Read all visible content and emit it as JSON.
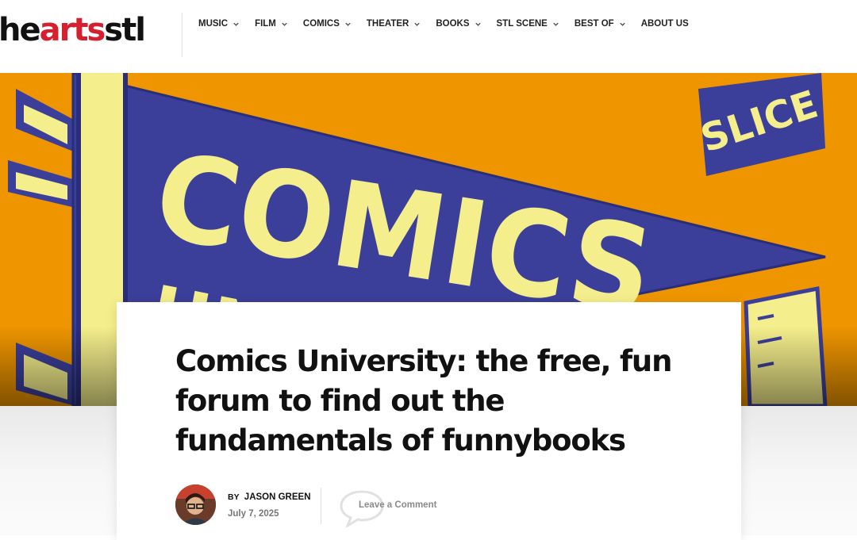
{
  "site": {
    "logo_part1": "he",
    "logo_part2": "arts",
    "logo_part3": "stl",
    "logo_color_dark": "#111111",
    "logo_color_red": "#d6202f"
  },
  "nav": {
    "items": [
      {
        "label": "MUSIC",
        "has_dropdown": true
      },
      {
        "label": "FILM",
        "has_dropdown": true
      },
      {
        "label": "COMICS",
        "has_dropdown": true
      },
      {
        "label": "THEATER",
        "has_dropdown": true
      },
      {
        "label": "BOOKS",
        "has_dropdown": true
      },
      {
        "label": "STL SCENE",
        "has_dropdown": true
      },
      {
        "label": "BEST OF",
        "has_dropdown": true
      },
      {
        "label": "ABOUT US",
        "has_dropdown": false
      }
    ],
    "dropdown_icon": "chevron-down-icon"
  },
  "hero": {
    "banner_line1": "COMICS",
    "banner_line2": "UNIVERSITY",
    "corner_text": "SLICE",
    "background_color": "#ee9500",
    "pennant_color": "#3b3f9a",
    "lettering_color": "#f4ee8c"
  },
  "article": {
    "title": "Comics University: the free, fun forum to find out the fundamentals of funnybooks",
    "by_prefix": "BY",
    "author": "JASON GREEN",
    "date": "July 7, 2025",
    "comment_link": "Leave a Comment",
    "comment_icon": "speech-bubble-icon"
  }
}
